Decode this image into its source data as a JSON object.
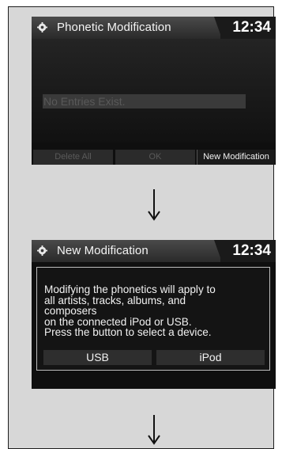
{
  "screen1": {
    "title": "Phonetic Modification",
    "clock": "12:34",
    "entry_placeholder": "No Entries Exist.",
    "softkeys": [
      "Delete All",
      "OK",
      "New Modification"
    ]
  },
  "screen2": {
    "title": "New Modification",
    "clock": "12:34",
    "message": "Modifying the phonetics will apply to\nall artists, tracks, albums, and\ncomposers\non the connected iPod or USB.\nPress the button to select a device.",
    "buttons": [
      "USB",
      "iPod"
    ]
  },
  "icons": {
    "settings": "gear-icon",
    "flow_arrow": "arrow-down-icon"
  },
  "colors": {
    "screen_bg": "#0f0f0f",
    "titlebar": "#3a3a3a",
    "panel_bg": "#d7d7d7"
  }
}
